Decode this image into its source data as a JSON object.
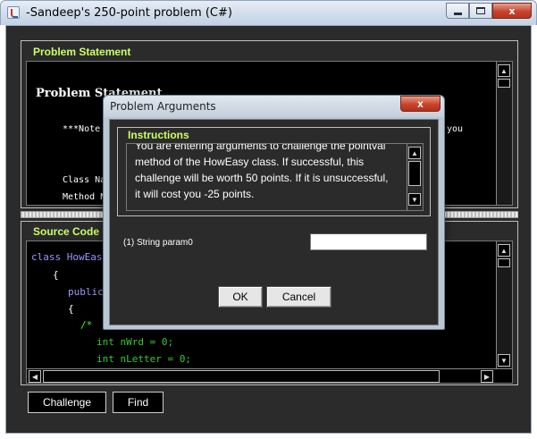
{
  "window": {
    "title": "-Sandeep's 250-point problem (C#)",
    "controls": {
      "minimize": "",
      "maximize": "",
      "close": "x"
    }
  },
  "problem_statement": {
    "panel_title": "Problem Statement",
    "heading": "Problem Statement",
    "lines": [
      "***Note",
      "you",
      "Class Na",
      "Method N"
    ]
  },
  "source_code": {
    "panel_title": "Source Code",
    "lines": [
      "class HowEasy",
      "{",
      "public",
      "{",
      "/*",
      "int nWrd = 0;",
      "int nLetter = 0;"
    ]
  },
  "buttons": {
    "challenge": "Challenge",
    "find": "Find"
  },
  "dialog": {
    "title": "Problem Arguments",
    "close": "x",
    "instructions_title": "Instructions",
    "instructions_lines": [
      "You are entering arguments to challenge the pointval",
      "method of the HowEasy class.  If successful, this",
      "challenge will be worth 50 points. If it is unsuccessful,",
      "it will cost you -25 points."
    ],
    "param_label": "(1) String param0",
    "param_value": "",
    "ok": "OK",
    "cancel": "Cancel"
  },
  "colors": {
    "panel_bg": "#2b2b2b",
    "text_area_bg": "#000000",
    "panel_title": "#ccff66",
    "keyword": "#9999ff",
    "code_green": "#33cc33"
  },
  "icons": {
    "app": "java-app-icon",
    "scroll_up": "arrow-up-icon",
    "scroll_down": "arrow-down-icon",
    "scroll_left": "arrow-left-icon",
    "scroll_right": "arrow-right-icon"
  }
}
